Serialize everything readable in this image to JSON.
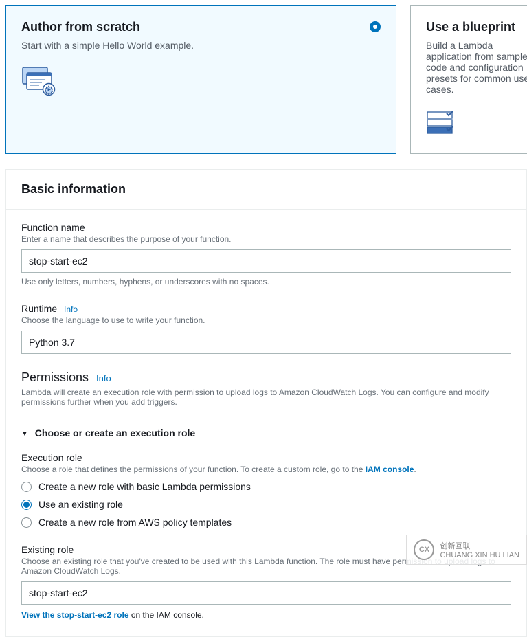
{
  "cards": {
    "scratch": {
      "title": "Author from scratch",
      "desc": "Start with a simple Hello World example."
    },
    "blueprint": {
      "title": "Use a blueprint",
      "desc": "Build a Lambda application from sample code and configuration presets for common use cases."
    }
  },
  "panel": {
    "title": "Basic information"
  },
  "funcName": {
    "label": "Function name",
    "hint": "Enter a name that describes the purpose of your function.",
    "value": "stop-start-ec2",
    "constraint": "Use only letters, numbers, hyphens, or underscores with no spaces."
  },
  "runtime": {
    "label": "Runtime",
    "info": "Info",
    "hint": "Choose the language to use to write your function.",
    "value": "Python 3.7"
  },
  "perm": {
    "title": "Permissions",
    "info": "Info",
    "desc": "Lambda will create an execution role with permission to upload logs to Amazon CloudWatch Logs. You can configure and modify permissions further when you add triggers."
  },
  "expander": {
    "label": "Choose or create an execution role"
  },
  "execRole": {
    "label": "Execution role",
    "hint_pre": "Choose a role that defines the permissions of your function. To create a custom role, go to the ",
    "hint_link": "IAM console",
    "hint_post": ".",
    "opts": {
      "new": "Create a new role with basic Lambda permissions",
      "existing": "Use an existing role",
      "template": "Create a new role from AWS policy templates"
    }
  },
  "existing": {
    "label": "Existing role",
    "hint": "Choose an existing role that you've created to be used with this Lambda function. The role must have permission to upload logs to Amazon CloudWatch Logs.",
    "value": "stop-start-ec2",
    "view_link": "View the stop-start-ec2 role",
    "view_post": " on the IAM console."
  },
  "watermark": {
    "top": "创新互联",
    "bottom": "CHUANG XIN HU LIAN"
  }
}
